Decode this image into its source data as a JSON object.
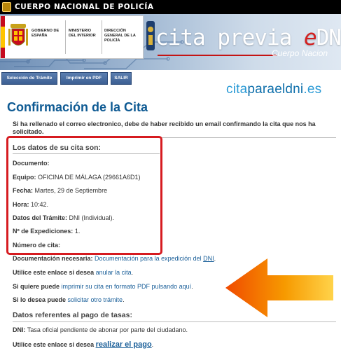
{
  "header": {
    "top_title": "CUERPO NACIONAL DE POLICÍA",
    "gov_label": "GOBIERNO DE ESPAÑA",
    "ministry": "MINISTERIO DEL INTERIOR",
    "directorate": "DIRECCIÓN GENERAL DE LA POLICÍA",
    "app_title_prefix": "cita previa ",
    "app_title_e": "e",
    "app_title_suffix": "DNI-Pas",
    "subtitle": "Cuerpo Nacion"
  },
  "toolbar": {
    "tramite_label": "Selección de Trámite",
    "pdf_label": "Imprimir en PDF",
    "exit_label": "SALIR"
  },
  "logo": {
    "part1": "cita",
    "part2": "paraeldni",
    "part3": ".es"
  },
  "page": {
    "title": "Confirmación de la Cita",
    "intro": "Si ha rellenado el correo electronico, debe de haber recibido un email confirmando la cita que nos ha solicitado."
  },
  "appointment": {
    "heading": "Los datos de su cita son:",
    "documento_label": "Documento:",
    "equipo_label": "Equipo:",
    "equipo_value": " OFICINA DE MÁLAGA (29661A6D1)",
    "fecha_label": "Fecha:",
    "fecha_value": " Martes, 29 de Septiembre",
    "hora_label": "Hora:",
    "hora_value": " 10:42.",
    "tramite_label": "Datos del Trámite:",
    "tramite_value": " DNI (Individual).",
    "expediciones_label": "Nº de Expediciones:",
    "expediciones_value": " 1.",
    "numero_label": "Número de cita:"
  },
  "links": {
    "doc_label": "Documentación necesaria:",
    "doc_link_prefix": " Documentación para la expedición del ",
    "doc_link_dni": "DNI",
    "doc_end": ".",
    "cancel_text": "Utilice este enlace si desea ",
    "cancel_link": "anular la cita",
    "cancel_end": ".",
    "print_text": "Si quiere puede ",
    "print_link": "imprimir su cita en formato PDF pulsando aquí",
    "print_end": ".",
    "other_text": "Si lo desea puede ",
    "other_link": "solicitar otro trámite",
    "other_end": "."
  },
  "fees": {
    "heading": "Datos referentes al pago de tasas:",
    "dni_label": "DNI:",
    "dni_value": " Tasa oficial pendiente de abonar por parte del ciudadano.",
    "pay_text": "Utilice este enlace si desea ",
    "pay_link": "realizar el pago",
    "pay_end": "."
  },
  "colors": {
    "brand_blue": "#0e5a93",
    "highlight_red": "#d61b20",
    "arrow_orange": "#f5a000"
  },
  "icons": [
    "seal-icon",
    "coat-of-arms-icon",
    "police-badge-icon",
    "arrow-icon"
  ]
}
